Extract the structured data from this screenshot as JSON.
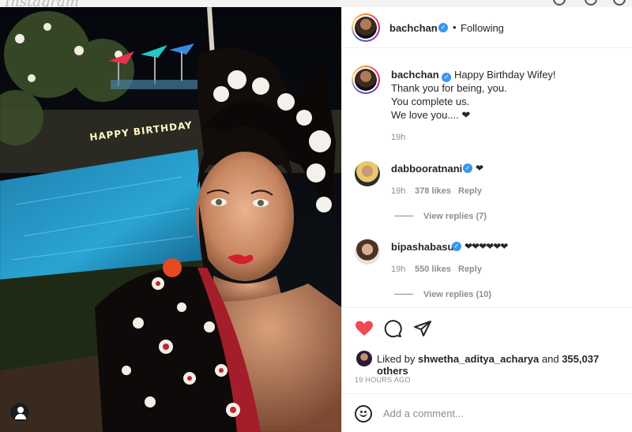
{
  "app": {
    "logo_text": "Instagram"
  },
  "post": {
    "author": "bachchan",
    "follow_status": "Following",
    "separator": "•",
    "verified_mark": "✓",
    "caption_lines": [
      "Happy Birthday Wifey!",
      "Thank you for being, you.",
      "You complete us.",
      "We love you.... ❤"
    ],
    "caption_time": "19h",
    "photo_sign_text": "HAPPY BIRTHDAY"
  },
  "comments": [
    {
      "user": "dabbooratnani",
      "text": "❤",
      "time": "19h",
      "likes": "378 likes",
      "reply": "Reply",
      "view_replies": "View replies (7)"
    },
    {
      "user": "bipashabasu",
      "text": "❤❤❤❤❤❤",
      "time": "19h",
      "likes": "550 likes",
      "reply": "Reply",
      "view_replies": "View replies (10)"
    }
  ],
  "likes": {
    "prefix": "Liked by",
    "user": "shwetha_aditya_acharya",
    "and": "and",
    "count": "355,037 others"
  },
  "time_ago": "19 HOURS AGO",
  "comment_input": {
    "placeholder": "Add a comment..."
  },
  "colors": {
    "heart": "#ed4956",
    "verified": "#3897f0",
    "text": "#262626",
    "muted": "#8e8e8e"
  },
  "icons": [
    "heart-icon",
    "comment-icon",
    "share-icon",
    "emoji-icon",
    "verified-icon",
    "account-icon"
  ]
}
